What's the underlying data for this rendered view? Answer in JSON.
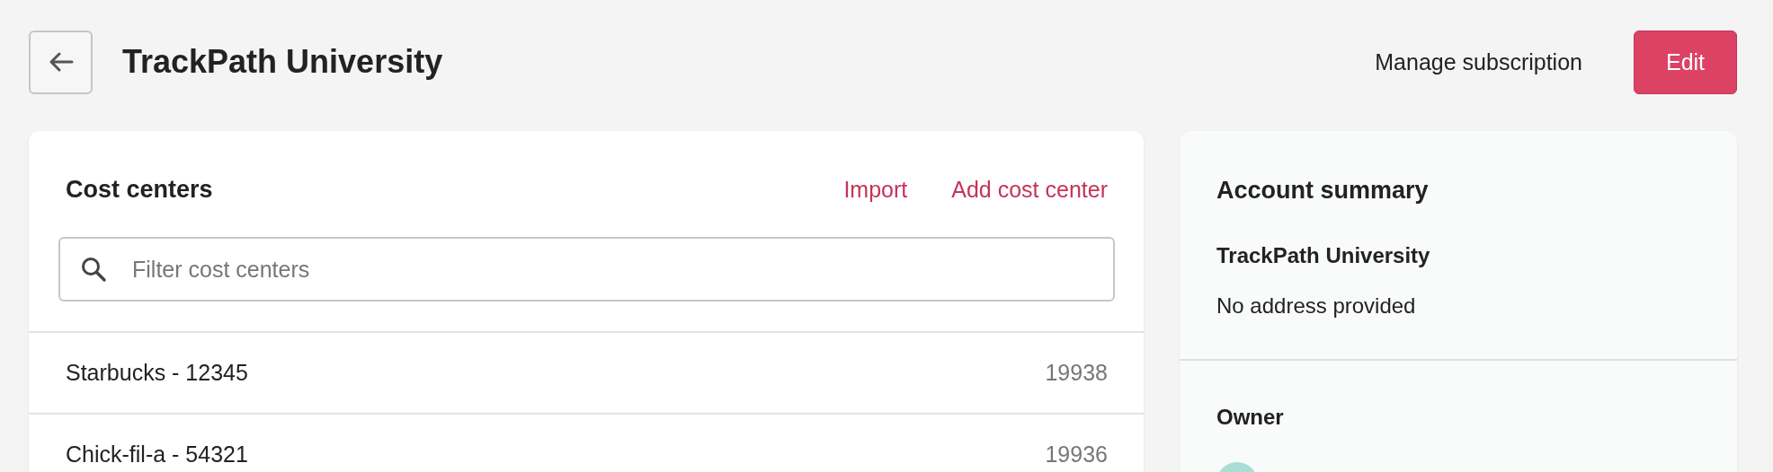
{
  "header": {
    "title": "TrackPath University",
    "manage_link": "Manage subscription",
    "edit_button": "Edit"
  },
  "cost_centers": {
    "title": "Cost centers",
    "actions": [
      "Import",
      "Add cost center"
    ],
    "search": {
      "placeholder": "Filter cost centers"
    },
    "rows": [
      {
        "name": "Starbucks - 12345",
        "number": "19938"
      },
      {
        "name": "Chick-fil-a - 54321",
        "number": "19936"
      }
    ]
  },
  "account_summary": {
    "title": "Account summary",
    "org_name": "TrackPath University",
    "address": "No address provided",
    "owner_label": "Owner"
  }
}
